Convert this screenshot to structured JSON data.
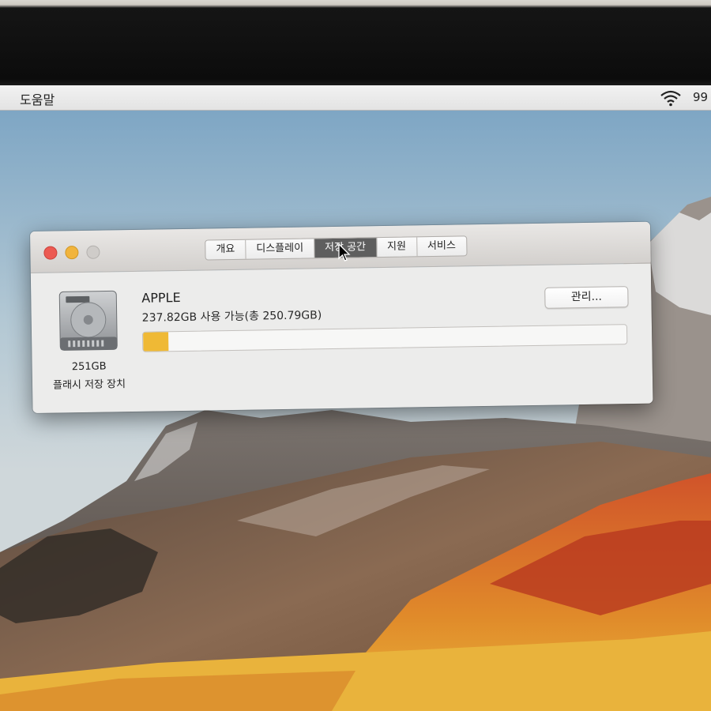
{
  "menubar": {
    "help_label": "도움말",
    "wifi_icon": "wifi-icon",
    "battery_text": "99"
  },
  "window": {
    "tabs": [
      {
        "label": "개요",
        "active": false
      },
      {
        "label": "디스플레이",
        "active": false
      },
      {
        "label": "저장 공간",
        "active": true
      },
      {
        "label": "지원",
        "active": false
      },
      {
        "label": "서비스",
        "active": false
      }
    ],
    "disk": {
      "icon": "hard-drive-icon",
      "size": "251GB",
      "type": "플래시 저장 장치"
    },
    "volume": {
      "name": "APPLE",
      "available": "237.82GB 사용 가능(총 250.79GB)",
      "used_fraction": 0.052
    },
    "manage_label": "관리...",
    "colors": {
      "used_bar": "#efb935",
      "close": "#ec5a52",
      "minimize": "#f1b43c"
    }
  }
}
